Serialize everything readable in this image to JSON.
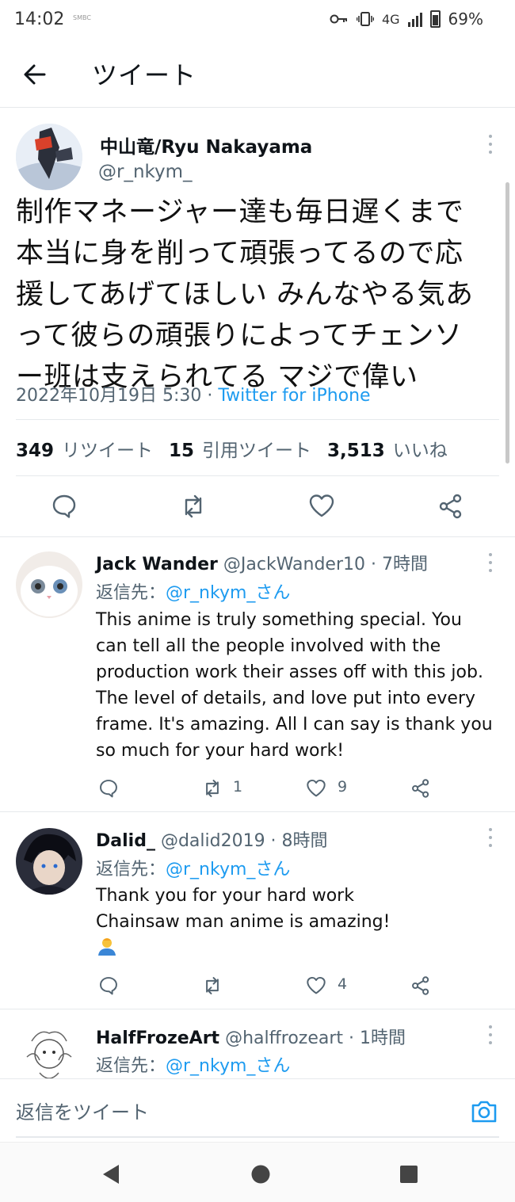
{
  "status_bar": {
    "time": "14:02",
    "carrier": "SMBC",
    "network": "4G",
    "battery": "69%"
  },
  "header": {
    "title": "ツイート"
  },
  "tweet": {
    "author_name": "中山竜/Ryu Nakayama",
    "author_handle": "@r_nkym_",
    "text_lines": [
      "制作マネージャー達も毎日遅くまで",
      "本当に身を削って頑張ってるので応",
      "援してあげてほしい みんなやる気あ",
      "って彼らの頑張りによってチェンソ",
      "ー班は支えられてる マジで偉い"
    ],
    "timestamp": "2022年10月19日 5:30",
    "separator": " · ",
    "source": "Twitter for iPhone",
    "retweets_count": "349",
    "retweets_label": "リツイート",
    "quotes_count": "15",
    "quotes_label": "引用ツイート",
    "likes_count": "3,513",
    "likes_label": "いいね"
  },
  "replies": [
    {
      "name": "Jack Wander",
      "handle": "@JackWander10",
      "time": " · 7時間",
      "reply_to_label": "返信先：",
      "reply_to_handle": "@r_nkym_さん",
      "text_lines": [
        "This anime is truly something special. You",
        "can tell all the people involved with the",
        "production work their asses off with this job.",
        "The level of details, and love put into every",
        "frame. It's amazing. All I can say is thank you",
        "so much for your hard work!"
      ],
      "retweets": "1",
      "likes": "9"
    },
    {
      "name": "Dalid_",
      "handle": "@dalid2019",
      "time": " · 8時間",
      "reply_to_label": "返信先：",
      "reply_to_handle": "@r_nkym_さん",
      "text_lines": [
        "Thank you for your hard work",
        "Chainsaw man anime is amazing!"
      ],
      "retweets": "",
      "likes": "4"
    },
    {
      "name": "HalfFrozeArt",
      "handle": "@halffrozeart",
      "time": " · 1時間",
      "reply_to_label": "返信先：",
      "reply_to_handle": "@r_nkym_さん"
    }
  ],
  "compose": {
    "placeholder": "返信をツイート"
  },
  "colors": {
    "accent": "#1d9bf0",
    "secondary_text": "#536471",
    "divider": "#e6e9ec"
  },
  "icons": [
    "back-arrow-icon",
    "more-icon",
    "reply-icon",
    "retweet-icon",
    "like-icon",
    "share-icon",
    "camera-icon",
    "nav-back-icon",
    "nav-home-icon",
    "nav-recents-icon"
  ]
}
